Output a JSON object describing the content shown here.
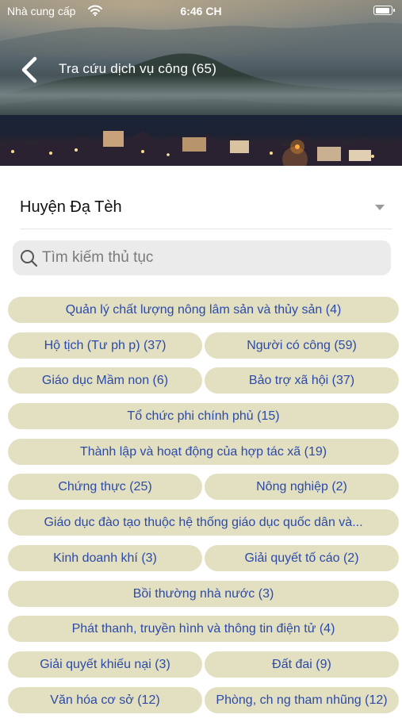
{
  "status_bar": {
    "carrier": "Nhà cung cấp",
    "time": "6:46 CH",
    "icons": [
      "wifi-icon",
      "battery-icon"
    ],
    "battery_level": 0.9
  },
  "nav": {
    "title": "Tra cứu dịch vụ công (65)",
    "back_icon": "chevron-left-icon"
  },
  "district": {
    "selected": "Huyện Đạ Tèh",
    "icon": "caret-down-icon"
  },
  "search": {
    "placeholder": "Tìm kiếm thủ tục",
    "value": "",
    "icon": "search-icon"
  },
  "colors": {
    "chip_background": "#e3e0c2",
    "chip_text": "#2c4aa8",
    "search_background": "#ebebeb"
  },
  "categories": {
    "rows": [
      [
        {
          "label": "Quản lý chất lượng nông lâm sản và thủy sản (4)"
        }
      ],
      [
        {
          "label": "Hộ tịch (Tư ph  p) (37)"
        },
        {
          "label": "Người có công (59)"
        }
      ],
      [
        {
          "label": "Giáo dục Mầm non (6)"
        },
        {
          "label": "Bảo trợ xã hội (37)"
        }
      ],
      [
        {
          "label": "Tổ chức phi chính phủ (15)"
        }
      ],
      [
        {
          "label": "Thành lập và hoạt động của hợp tác xã (19)"
        }
      ],
      [
        {
          "label": "Chứng thực (25)"
        },
        {
          "label": "Nông nghiệp (2)"
        }
      ],
      [
        {
          "label": "Giáo dục đào tạo thuộc hệ thống giáo dục quốc dân và..."
        }
      ],
      [
        {
          "label": "Kinh doanh khí (3)"
        },
        {
          "label": "Giải quyết tố cáo (2)"
        }
      ],
      [
        {
          "label": "Bồi thường nhà nước (3)"
        }
      ],
      [
        {
          "label": "Phát thanh, truyền hình và thông tin điện tử (4)"
        }
      ],
      [
        {
          "label": "Giải quyết khiếu nại (3)"
        },
        {
          "label": "Đất đai (9)"
        }
      ],
      [
        {
          "label": "Văn hóa cơ sở (12)"
        },
        {
          "label": "Phòng, ch  ng tham nhũng (12)"
        }
      ]
    ]
  }
}
